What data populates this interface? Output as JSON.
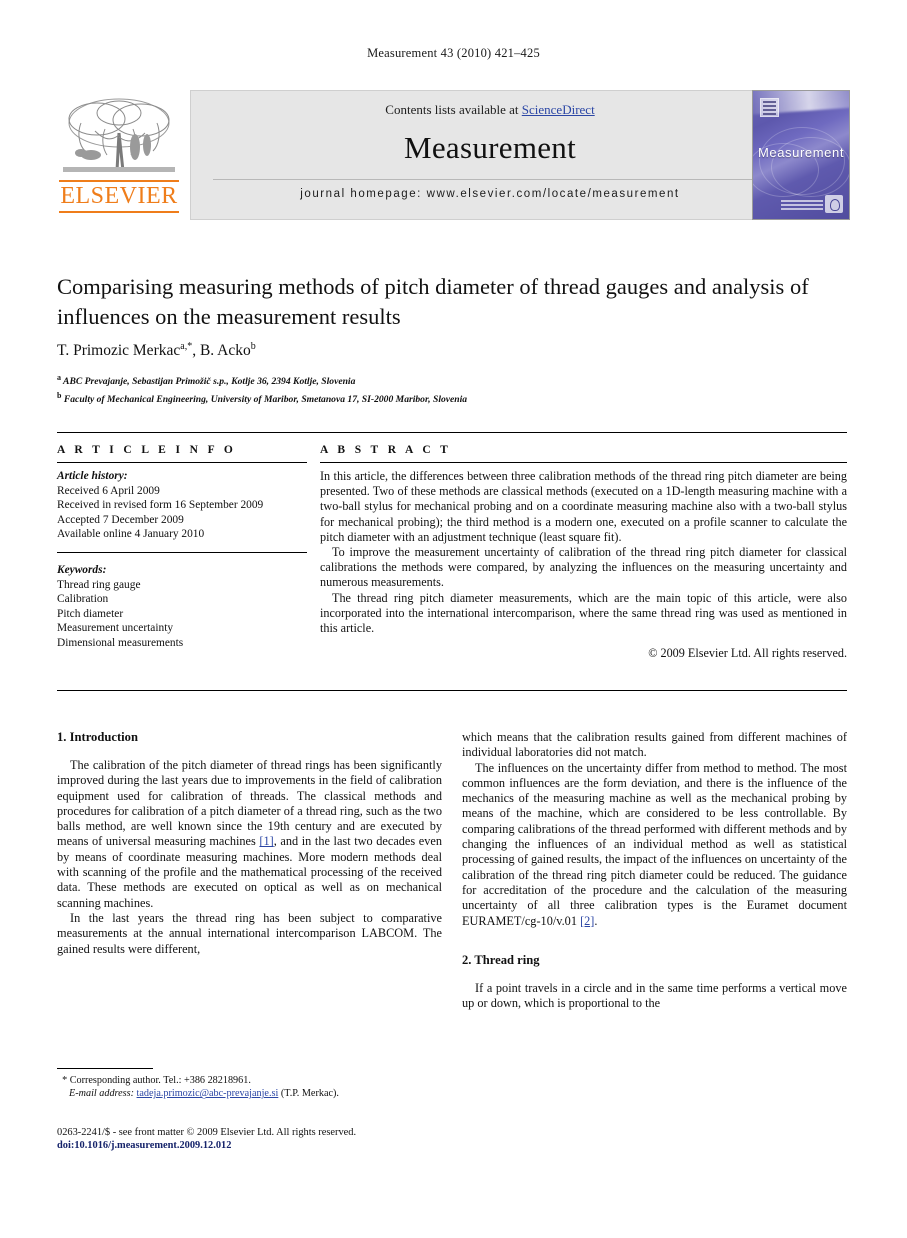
{
  "running_head": "Measurement 43 (2010) 421–425",
  "masthead": {
    "contents_prefix": "Contents lists available at ",
    "sciencedirect": "ScienceDirect",
    "journal_title": "Measurement",
    "homepage": "journal homepage: www.elsevier.com/locate/measurement",
    "publisher_logo_text": "ELSEVIER",
    "cover_title": "Measurement"
  },
  "article": {
    "title": "Comparising measuring methods of pitch diameter of thread gauges and analysis of influences on the measurement results",
    "authors_html": "T. Primozic Merkac<sup>a,*</sup>, B. Acko<sup>b</sup>",
    "affiliation_a": "ABC Prevajanje, Sebastijan Primožič s.p., Kotlje 36, 2394 Kotlje, Slovenia",
    "affiliation_b": "Faculty of Mechanical Engineering, University of Maribor, Smetanova 17, SI-2000 Maribor, Slovenia"
  },
  "info": {
    "heading": "A R T I C L E     I N F O",
    "history_label": "Article history:",
    "history": [
      "Received 6 April 2009",
      "Received in revised form 16 September 2009",
      "Accepted 7 December 2009",
      "Available online 4 January 2010"
    ],
    "keywords_label": "Keywords:",
    "keywords": [
      "Thread ring gauge",
      "Calibration",
      "Pitch diameter",
      "Measurement uncertainty",
      "Dimensional measurements"
    ]
  },
  "abstract": {
    "heading": "A B S T R A C T",
    "paragraphs": [
      "In this article, the differences between three calibration methods of the thread ring pitch diameter are being presented. Two of these methods are classical methods (executed on a 1D-length measuring machine with a two-ball stylus for mechanical probing and on a coordinate measuring machine also with a two-ball stylus for mechanical probing); the third method is a modern one, executed on a profile scanner to calculate the pitch diameter with an adjustment technique (least square fit).",
      "To improve the measurement uncertainty of calibration of the thread ring pitch diameter for classical calibrations the methods were compared, by analyzing the influences on the measuring uncertainty and numerous measurements.",
      "The thread ring pitch diameter measurements, which are the main topic of this article, were also incorporated into the international intercomparison, where the same thread ring was used as mentioned in this article."
    ],
    "copyright": "© 2009 Elsevier Ltd. All rights reserved."
  },
  "body": {
    "section1_heading": "1. Introduction",
    "left_p1": "The calibration of the pitch diameter of thread rings has been significantly improved during the last years due to improvements in the field of calibration equipment used for calibration of threads. The classical methods and procedures for calibration of a pitch diameter of a thread ring, such as the two balls method, are well known since the 19th century and are executed by means of universal measuring machines ",
    "left_p1_ref": "[1]",
    "left_p1_cont": ", and in the last two decades even by means of coordinate measuring machines. More modern methods deal with scanning of the profile and the mathematical processing of the received data. These methods are executed on optical as well as on mechanical scanning machines.",
    "left_p2": "In the last years the thread ring has been subject to comparative measurements at the annual international intercomparison LABCOM. The gained results were different,",
    "right_p1": "which means that the calibration results gained from different machines of individual laboratories did not match.",
    "right_p2": "The influences on the uncertainty differ from method to method. The most common influences are the form deviation, and there is the influence of the mechanics of the measuring machine as well as the mechanical probing by means of the machine, which are considered to be less controllable. By comparing calibrations of the thread performed with different methods and by changing the influences of an individual method as well as statistical processing of gained results, the impact of the influences on uncertainty of the calibration of the thread ring pitch diameter could be reduced. The guidance for accreditation of the procedure and the calculation of the measuring uncertainty of all three calibration types is the Euramet document EURAMET/cg-10/v.01 ",
    "right_p2_ref": "[2]",
    "right_p2_cont": ".",
    "section2_heading": "2. Thread ring",
    "right_p3": "If a point travels in a circle and in the same time performs a vertical move up or down, which is proportional to the"
  },
  "footnotes": {
    "corresponding": "Corresponding author. Tel.: +386 28218961.",
    "email_label": "E-mail address:",
    "email": "tadeja.primozic@abc-prevajanje.si",
    "email_suffix": "(T.P. Merkac).",
    "imprint": "0263-2241/$ - see front matter © 2009 Elsevier Ltd. All rights reserved.",
    "doi": "doi:10.1016/j.measurement.2009.12.012"
  }
}
